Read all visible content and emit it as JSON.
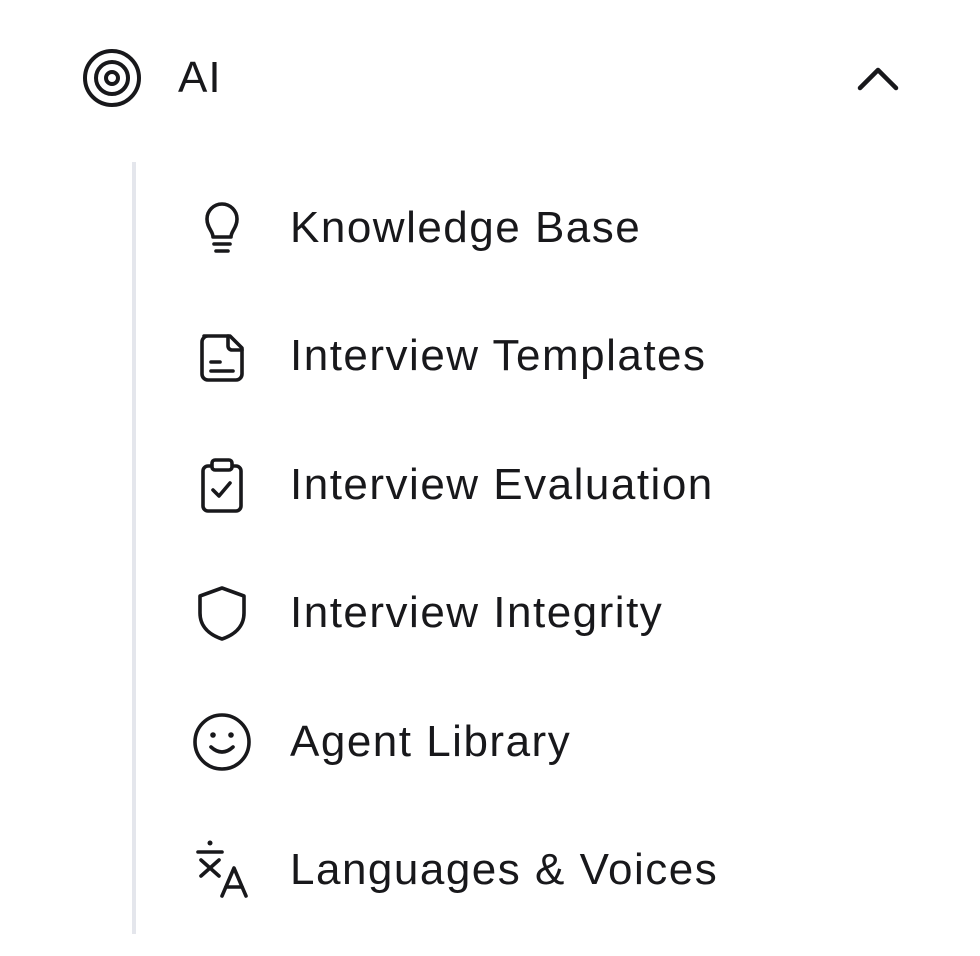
{
  "group": {
    "label": "AI",
    "icon": "target-icon",
    "expanded": true,
    "chevron_icon": "chevron-up-icon"
  },
  "items": [
    {
      "label": "Knowledge Base",
      "icon": "lightbulb-icon"
    },
    {
      "label": "Interview Templates",
      "icon": "sticky-note-icon"
    },
    {
      "label": "Interview Evaluation",
      "icon": "clipboard-check-icon"
    },
    {
      "label": "Interview Integrity",
      "icon": "shield-icon"
    },
    {
      "label": "Agent Library",
      "icon": "smiley-icon"
    },
    {
      "label": "Languages & Voices",
      "icon": "translate-icon"
    }
  ],
  "colors": {
    "text": "#18181b",
    "divider": "#e4e6ec",
    "background": "#ffffff"
  }
}
